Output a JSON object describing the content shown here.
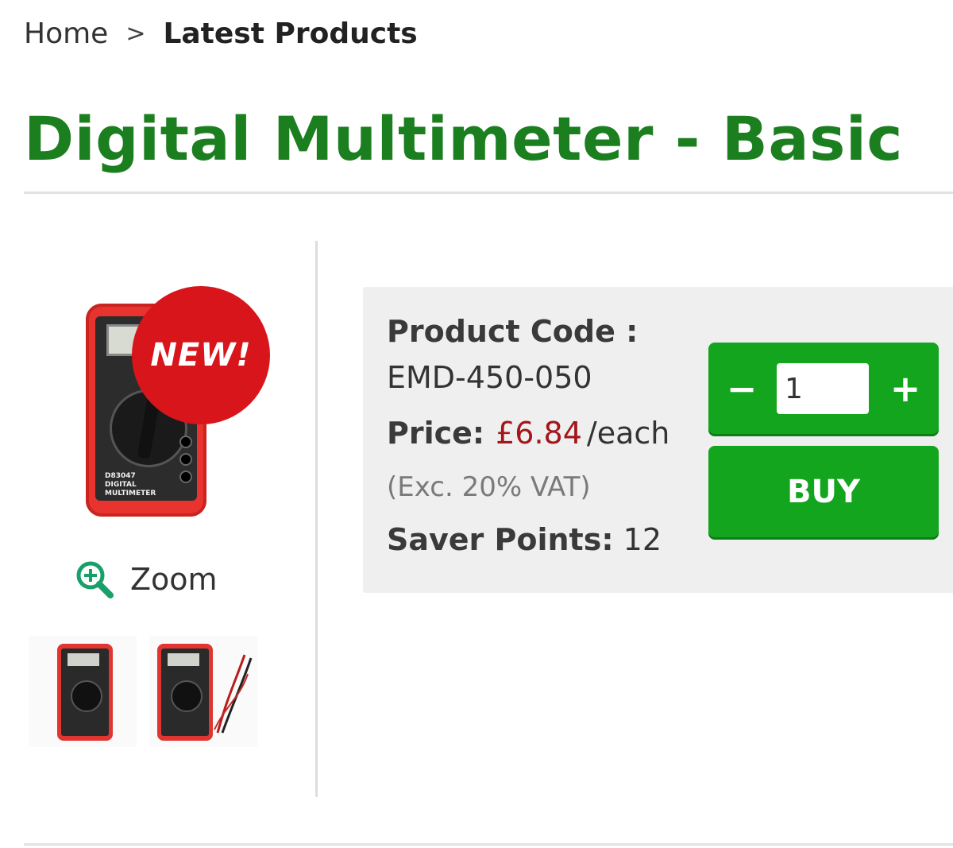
{
  "breadcrumb": {
    "home": "Home",
    "separator": ">",
    "current": "Latest Products"
  },
  "product": {
    "title": "Digital Multimeter - Basic",
    "badge": "NEW!",
    "image_text": [
      "D83047",
      "DIGITAL",
      "MULTIMETER"
    ],
    "zoom_label": "Zoom",
    "code_label": "Product Code :",
    "code_value": "EMD-450-050",
    "price_label": "Price:",
    "price_value": "£6.84",
    "price_unit": "/each",
    "vat_note": "(Exc. 20% VAT)",
    "points_label": "Saver Points:",
    "points_value": "12"
  },
  "cart": {
    "minus": "−",
    "plus": "+",
    "quantity": "1",
    "buy_label": "BUY"
  },
  "colors": {
    "title": "#1b7f1f",
    "price": "#a3161a",
    "button": "#14a51f",
    "badge": "#d7151b",
    "panel": "#efefef"
  },
  "icons": {
    "zoom": "zoom-in-magnifier-icon"
  }
}
